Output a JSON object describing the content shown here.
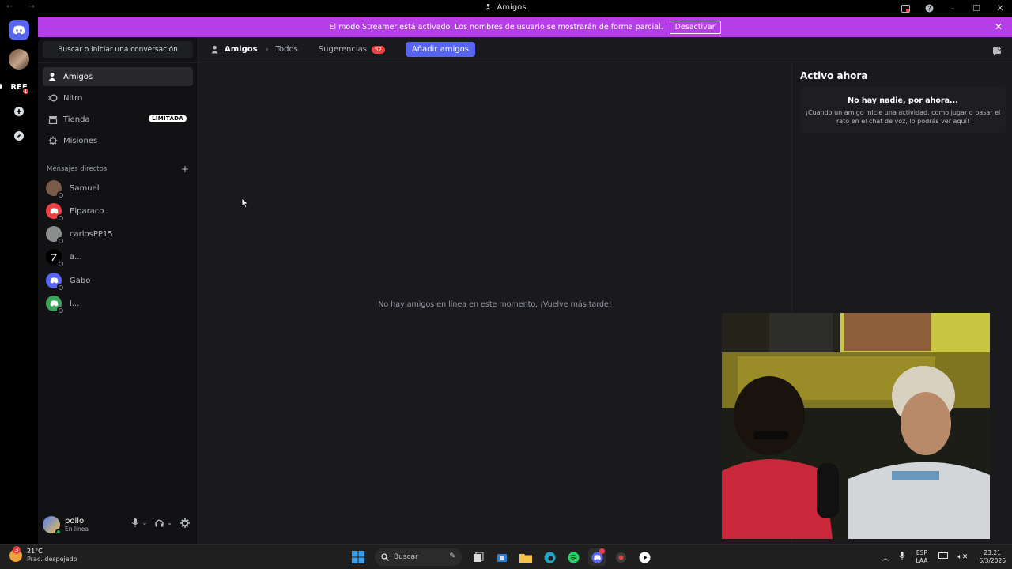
{
  "window": {
    "title": "Amigos",
    "nav_arrows": "← →"
  },
  "banner": {
    "message": "El modo Streamer está activado. Los nombres de usuario se mostrarán de forma parcial.",
    "button": "Desactivar",
    "close": "✕"
  },
  "rail": {
    "server_ref": "REF",
    "ref_badge": "1"
  },
  "sidebar": {
    "search_label": "Buscar o iniciar una conversación",
    "nav": [
      {
        "label": "Amigos"
      },
      {
        "label": "Nitro"
      },
      {
        "label": "Tienda",
        "tag": "LIMITADA"
      },
      {
        "label": "Misiones"
      }
    ],
    "dm_header": "Mensajes directos",
    "dm_add": "+",
    "dms": [
      {
        "name": "Samuel",
        "color": "#7a5a48"
      },
      {
        "name": "Elparaco",
        "color": "#f23f43"
      },
      {
        "name": "carlosPP15",
        "color": "#8a8f8d"
      },
      {
        "name": "a...",
        "color": "#000000"
      },
      {
        "name": "Gabo",
        "color": "#5865f2"
      },
      {
        "name": "l...",
        "color": "#3ba55c"
      }
    ]
  },
  "user": {
    "name": "pollo",
    "status": "En línea"
  },
  "topbar": {
    "title": "Amigos",
    "tabs": [
      {
        "label": "Todos"
      },
      {
        "label": "Sugerencias",
        "count": "52"
      }
    ],
    "add_friend": "Añadir amigos"
  },
  "main": {
    "empty_message": "No hay amigos en línea en este momento. ¡Vuelve más tarde!"
  },
  "activity": {
    "title": "Activo ahora",
    "card_title": "No hay nadie, por ahora...",
    "card_desc": "¡Cuando un amigo inicie una actividad, como jugar o pasar el rato en el chat de voz, lo podrás ver aquí!"
  },
  "taskbar": {
    "weather_temp": "21°C",
    "weather_cond": "Prac. despejado",
    "weather_badge": "3",
    "search_label": "Buscar",
    "lang_line1": "ESP",
    "lang_line2": "LAA",
    "time": "23:21",
    "date": "6/3/2026"
  },
  "colors": {
    "accent": "#5865f2",
    "banner": "#b53ee6",
    "danger": "#f23f43",
    "online": "#23a55a"
  }
}
